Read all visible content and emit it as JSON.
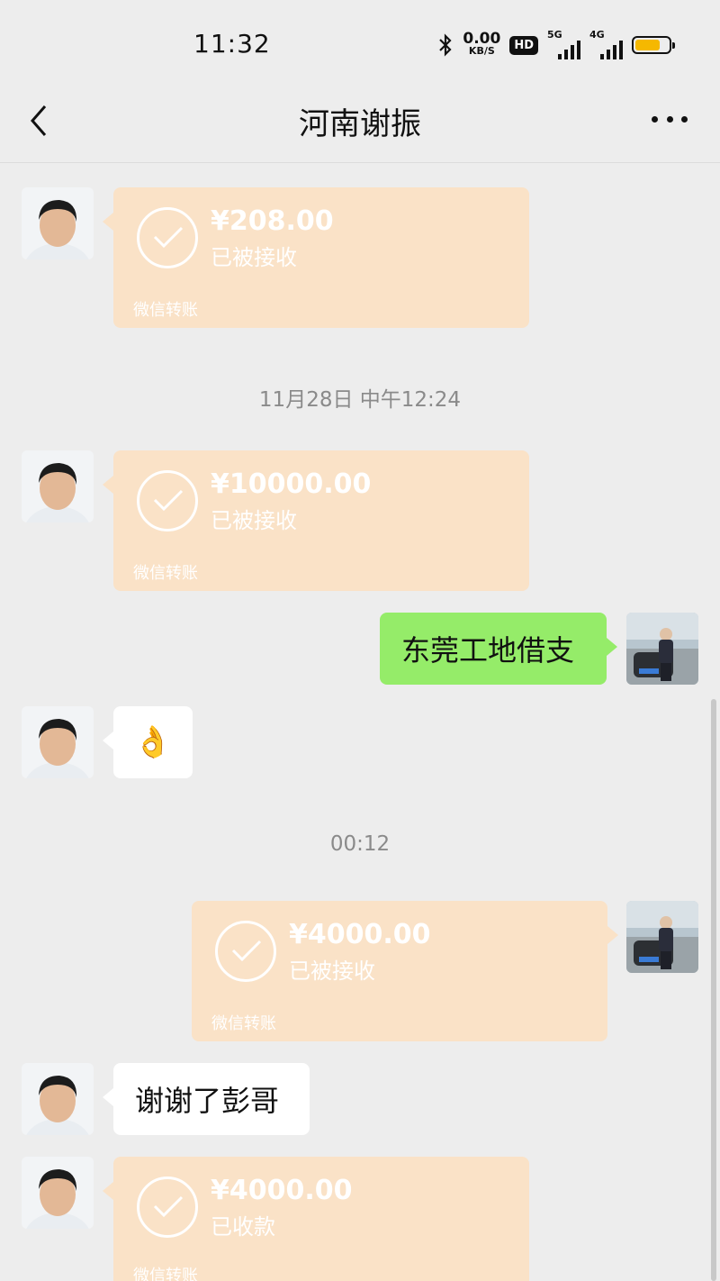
{
  "status_bar": {
    "time": "11:32",
    "net_speed_value": "0.00",
    "net_speed_unit": "KB/S",
    "hd_label": "HD",
    "sim1_label": "5G",
    "sim2_label": "4G",
    "battery_icon": "battery-icon",
    "bluetooth_icon": "bluetooth-icon"
  },
  "header": {
    "title": "河南谢振",
    "back_icon": "chevron-left-icon",
    "more_icon": "more-icon"
  },
  "colors": {
    "transfer_bg": "#fae2c7",
    "sent_bubble": "#95ec69",
    "received_bubble": "#ffffff",
    "background": "#ededed"
  },
  "messages": [
    {
      "type": "transfer",
      "side": "left",
      "amount": "¥208.00",
      "state": "已被接收",
      "footer": "微信转账"
    },
    {
      "type": "timestamp",
      "text": "11月28日 中午12:24"
    },
    {
      "type": "transfer",
      "side": "left",
      "amount": "¥10000.00",
      "state": "已被接收",
      "footer": "微信转账"
    },
    {
      "type": "text",
      "side": "right",
      "text": "东莞工地借支"
    },
    {
      "type": "emoji",
      "side": "left",
      "text": "👌"
    },
    {
      "type": "timestamp",
      "text": "00:12"
    },
    {
      "type": "transfer",
      "side": "right",
      "amount": "¥4000.00",
      "state": "已被接收",
      "footer": "微信转账"
    },
    {
      "type": "text",
      "side": "left",
      "text": "谢谢了彭哥"
    },
    {
      "type": "transfer",
      "side": "left",
      "amount": "¥4000.00",
      "state": "已收款",
      "footer": "微信转账"
    }
  ]
}
